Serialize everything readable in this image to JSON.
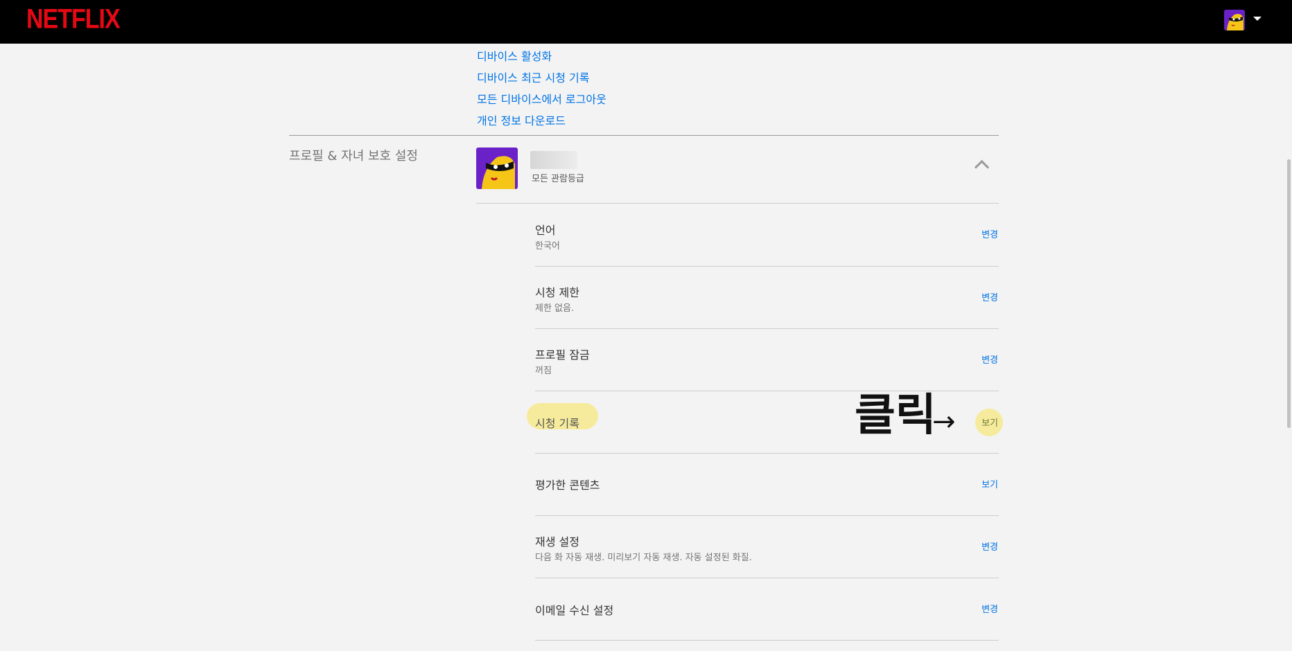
{
  "header": {
    "logo": "NETFLIX",
    "avatar_icon": "masked-bandit-avatar-icon",
    "caret_icon": "caret-down-icon"
  },
  "links": [
    "디바이스 활성화",
    "디바이스 최근 시청 기록",
    "모든 디바이스에서 로그아웃",
    "개인 정보 다운로드"
  ],
  "profile_section": {
    "label": "프로필 & 자녀 보호 설정",
    "profile": {
      "avatar_icon": "masked-bandit-avatar-icon",
      "rating": "모든 관람등급"
    },
    "rows": [
      {
        "title": "언어",
        "subtitle": "한국어",
        "action": "변경"
      },
      {
        "title": "시청 제한",
        "subtitle": "제한 없음.",
        "action": "변경"
      },
      {
        "title": "프로필 잠금",
        "subtitle": "꺼짐",
        "action": "변경"
      },
      {
        "title": "시청 기록",
        "subtitle": "",
        "action": "보기"
      },
      {
        "title": "평가한 콘텐츠",
        "subtitle": "",
        "action": "보기"
      },
      {
        "title": "재생 설정",
        "subtitle": "다음 화 자동 재생. 미리보기 자동 재생. 자동 설정된 화질.",
        "action": "변경"
      },
      {
        "title": "이메일 수신 설정",
        "subtitle": "",
        "action": "변경"
      }
    ]
  },
  "annotation": {
    "text": "클릭",
    "arrow": "→"
  },
  "colors": {
    "brand_red": "#e50914",
    "link_blue": "#0073e6",
    "highlight_yellow": "#f6eb9c"
  }
}
